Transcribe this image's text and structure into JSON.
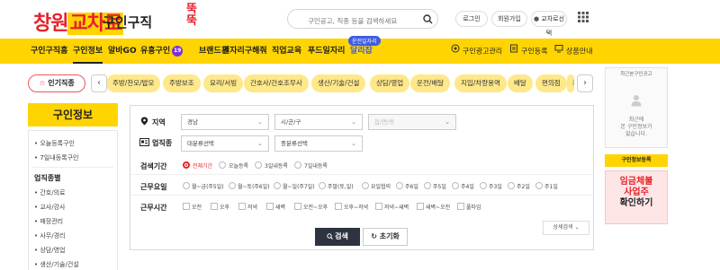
{
  "header": {
    "logo_text": "창원",
    "logo_accent": "교차로",
    "logo_sub": "구인구직",
    "logo_ttuk": "뚝뚝",
    "search_placeholder": "구인공고, 직종 등을 검색하세요",
    "login": "로그인",
    "signup": "회원가입",
    "site_select": "교차로선택"
  },
  "nav": {
    "items": [
      "구인구직홈",
      "구인정보",
      "알바GO",
      "유흥구인",
      "브랜드관",
      "일자리구해줘",
      "직업교육",
      "푸드일자리",
      "달리잡"
    ],
    "active": "구인정보",
    "badge_count": "19",
    "tooltip": "운전일자리",
    "right": [
      "구인광고관리",
      "구인등록",
      "상품안내"
    ]
  },
  "chips": {
    "hot_label": "인기직종",
    "items": [
      "주방/찬모/밥모",
      "주방보조",
      "요리/서빙",
      "간호사/간호조무사",
      "생산/기술/건설",
      "상담/영업",
      "운전/배달",
      "지입/차량용역",
      "배달",
      "편의점",
      "카페"
    ]
  },
  "sidebar": {
    "title": "구인정보",
    "items_top": [
      "오늘등록구인",
      "7일내등록구인"
    ],
    "section_head": "업직종별",
    "items_bottom": [
      "간호/의료",
      "교사/강사",
      "매장관리",
      "사무/경리",
      "상담/영업",
      "생산/기술/건설"
    ]
  },
  "filters": {
    "region_label": "지역",
    "region_sel1": "경남",
    "region_sel2": "시/군/구",
    "region_sel3": "읍/면/동",
    "job_label": "업직종",
    "job_sel1": "대분류선택",
    "job_sel2": "중분류선택",
    "period_label": "검색기간",
    "period_options": [
      "전체기간",
      "오늘등록",
      "3일내등록",
      "7일내등록"
    ],
    "period_selected": "전체기간",
    "days_label": "근무요일",
    "day_options": [
      "월~금(주5일)",
      "월~토(주6일)",
      "월~일(주7일)",
      "주말(토,일)",
      "요일협의",
      "주6일",
      "주5일",
      "주4일",
      "주3일",
      "주2일",
      "주1일"
    ],
    "hours_label": "근무시간",
    "hour_options": [
      "오전",
      "오후",
      "저녁",
      "새벽",
      "오전~오후",
      "오후~저녁",
      "저녁~새벽",
      "새벽~오전",
      "풀타임"
    ],
    "search_btn": "검색",
    "reset_btn": "초기화",
    "detail_btn": "상세검색"
  },
  "right_rail": {
    "recent_title": "최근본구인공고",
    "recent_msg_1": "최근에",
    "recent_msg_2": "본 구인정보가",
    "recent_msg_3": "없습니다.",
    "register_btn": "구인정보등록",
    "banner_line1": "임금체불",
    "banner_line2": "사업주",
    "banner_line3": "확인하기"
  },
  "colors": {
    "brand_red": "#e8202a",
    "brand_yellow": "#ffd400",
    "chip_yellow": "#ffe88a",
    "dark_btn": "#2d3340"
  }
}
